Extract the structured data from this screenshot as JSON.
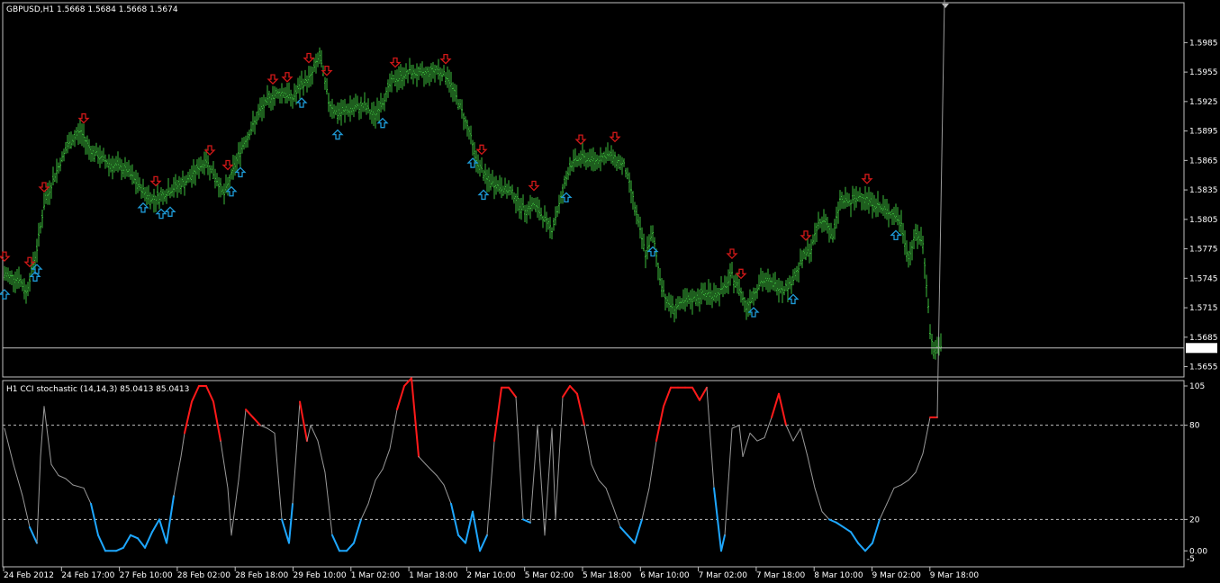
{
  "colors": {
    "background": "#000000",
    "frame": "#c0c0c0",
    "bar": "#3dbb3d",
    "buy_arrow": "#1e9ad6",
    "sell_arrow": "#d01818",
    "osc_line": "#9a9a9a",
    "osc_high": "#ff1a1a",
    "osc_low": "#1ea7ff",
    "price_tag_bg": "#ffffff",
    "price_tag_fg": "#000000"
  },
  "main_panel": {
    "title": "GBPUSD,H1  1.5668 1.5684 1.5668 1.5674",
    "price_ticks": [
      "1.5985",
      "1.5955",
      "1.5925",
      "1.5895",
      "1.5865",
      "1.5835",
      "1.5805",
      "1.5775",
      "1.5745",
      "1.5715",
      "1.5685",
      "1.5655"
    ],
    "current_price": "1.5674",
    "collapse_icon": "triangle-down-icon"
  },
  "sub_panel": {
    "title": "H1 CCI stochastic (14,14,3) 85.0413 85.0413",
    "level_ticks": [
      "105",
      "80",
      "20",
      "0.00"
    ],
    "second_bottom_tick": "-5"
  },
  "time_axis": [
    "24 Feb 2012",
    "24 Feb 17:00",
    "27 Feb 10:00",
    "28 Feb 02:00",
    "28 Feb 18:00",
    "29 Feb 10:00",
    "1 Mar 02:00",
    "1 Mar 18:00",
    "2 Mar 10:00",
    "5 Mar 02:00",
    "5 Mar 18:00",
    "6 Mar 10:00",
    "7 Mar 02:00",
    "7 Mar 18:00",
    "8 Mar 10:00",
    "9 Mar 02:00",
    "9 Mar 18:00"
  ],
  "chart_data": [
    {
      "type": "ohlc_bars",
      "symbol": "GBPUSD",
      "timeframe": "H1",
      "ylim": [
        1.565,
        1.6
      ],
      "close_path": [
        [
          0,
          1.5748
        ],
        [
          8,
          1.5745
        ],
        [
          12,
          1.573
        ],
        [
          18,
          1.5775
        ],
        [
          22,
          1.582
        ],
        [
          28,
          1.585
        ],
        [
          35,
          1.588
        ],
        [
          42,
          1.5895
        ],
        [
          48,
          1.5875
        ],
        [
          58,
          1.5862
        ],
        [
          68,
          1.5855
        ],
        [
          75,
          1.5838
        ],
        [
          82,
          1.5825
        ],
        [
          88,
          1.583
        ],
        [
          95,
          1.5838
        ],
        [
          102,
          1.5845
        ],
        [
          108,
          1.5858
        ],
        [
          112,
          1.5865
        ],
        [
          118,
          1.5845
        ],
        [
          122,
          1.583
        ],
        [
          126,
          1.585
        ],
        [
          132,
          1.588
        ],
        [
          138,
          1.59
        ],
        [
          142,
          1.5915
        ],
        [
          148,
          1.593
        ],
        [
          155,
          1.5935
        ],
        [
          160,
          1.5928
        ],
        [
          165,
          1.5942
        ],
        [
          170,
          1.595
        ],
        [
          175,
          1.5972
        ],
        [
          180,
          1.5925
        ],
        [
          185,
          1.5912
        ],
        [
          192,
          1.5918
        ],
        [
          200,
          1.592
        ],
        [
          205,
          1.591
        ],
        [
          210,
          1.5925
        ],
        [
          215,
          1.5945
        ],
        [
          220,
          1.595
        ],
        [
          225,
          1.5955
        ],
        [
          232,
          1.5952
        ],
        [
          240,
          1.5958
        ],
        [
          246,
          1.595
        ],
        [
          252,
          1.5925
        ],
        [
          258,
          1.5895
        ],
        [
          262,
          1.5865
        ],
        [
          268,
          1.5845
        ],
        [
          275,
          1.5838
        ],
        [
          282,
          1.5832
        ],
        [
          288,
          1.5815
        ],
        [
          294,
          1.582
        ],
        [
          300,
          1.5805
        ],
        [
          304,
          1.5795
        ],
        [
          308,
          1.582
        ],
        [
          314,
          1.586
        ],
        [
          320,
          1.5868
        ],
        [
          328,
          1.5865
        ],
        [
          334,
          1.587
        ],
        [
          338,
          1.5868
        ],
        [
          344,
          1.586
        ],
        [
          348,
          1.5835
        ],
        [
          352,
          1.58
        ],
        [
          356,
          1.577
        ],
        [
          360,
          1.579
        ],
        [
          364,
          1.5745
        ],
        [
          368,
          1.572
        ],
        [
          372,
          1.5715
        ],
        [
          378,
          1.572
        ],
        [
          384,
          1.5725
        ],
        [
          390,
          1.573
        ],
        [
          395,
          1.5728
        ],
        [
          400,
          1.5735
        ],
        [
          404,
          1.5748
        ],
        [
          408,
          1.5735
        ],
        [
          412,
          1.5715
        ],
        [
          416,
          1.573
        ],
        [
          420,
          1.5742
        ],
        [
          426,
          1.574
        ],
        [
          432,
          1.5735
        ],
        [
          436,
          1.5738
        ],
        [
          440,
          1.5752
        ],
        [
          444,
          1.5768
        ],
        [
          448,
          1.5775
        ],
        [
          452,
          1.58
        ],
        [
          456,
          1.5805
        ],
        [
          460,
          1.5785
        ],
        [
          464,
          1.5825
        ],
        [
          470,
          1.5822
        ],
        [
          476,
          1.583
        ],
        [
          482,
          1.5822
        ],
        [
          488,
          1.5815
        ],
        [
          494,
          1.581
        ],
        [
          498,
          1.58
        ],
        [
          502,
          1.5765
        ],
        [
          506,
          1.579
        ],
        [
          510,
          1.578
        ],
        [
          512,
          1.574
        ],
        [
          514,
          1.569
        ],
        [
          516,
          1.567
        ],
        [
          520,
          1.5675
        ]
      ],
      "current_price": 1.5674,
      "sell_arrows_at": [
        0,
        14,
        22,
        44,
        84,
        114,
        124,
        149,
        157,
        169,
        179,
        217,
        245,
        265,
        294,
        320,
        339,
        404,
        409,
        445,
        479
      ],
      "buy_arrows_at": [
        0,
        17,
        18,
        77,
        87,
        92,
        126,
        131,
        165,
        185,
        210,
        260,
        266,
        312,
        360,
        416,
        438,
        495
      ]
    },
    {
      "type": "line",
      "name": "H1 CCI stochastic (14,14,3)",
      "ylim": [
        -5,
        105
      ],
      "levels": [
        80,
        20
      ],
      "upper_colored_above": 80,
      "lower_colored_below": 20,
      "x": [
        0,
        5,
        10,
        14,
        18,
        20,
        22,
        26,
        30,
        34,
        38,
        44,
        48,
        52,
        56,
        62,
        66,
        70,
        74,
        78,
        82,
        86,
        90,
        94,
        98,
        100,
        104,
        108,
        112,
        116,
        120,
        124,
        126,
        130,
        134,
        138,
        142,
        146,
        150,
        154,
        158,
        160,
        164,
        168,
        170,
        174,
        178,
        182,
        186,
        190,
        194,
        198,
        202,
        206,
        210,
        214,
        218,
        222,
        226,
        230,
        234,
        240,
        244,
        248,
        252,
        256,
        260,
        264,
        268,
        272,
        276,
        280,
        284,
        288,
        292,
        296,
        300,
        304,
        306,
        310,
        314,
        318,
        322,
        326,
        330,
        334,
        338,
        342,
        346,
        350,
        354,
        358,
        362,
        366,
        370,
        374,
        378,
        382,
        386,
        390,
        394,
        398,
        400,
        404,
        408,
        410,
        414,
        418,
        422,
        426,
        430,
        434,
        438,
        442,
        446,
        450,
        454,
        458,
        462,
        466,
        470,
        474,
        478,
        482,
        486,
        490,
        494,
        498,
        502,
        506,
        510,
        514,
        518,
        522
      ],
      "values": [
        78,
        55,
        35,
        15,
        5,
        60,
        92,
        55,
        48,
        46,
        42,
        40,
        30,
        10,
        0,
        0,
        2,
        10,
        8,
        2,
        12,
        20,
        5,
        35,
        60,
        75,
        95,
        105,
        105,
        95,
        70,
        40,
        10,
        45,
        90,
        85,
        80,
        78,
        75,
        20,
        5,
        30,
        95,
        70,
        80,
        70,
        50,
        10,
        0,
        0,
        5,
        20,
        30,
        45,
        52,
        65,
        90,
        105,
        110,
        60,
        55,
        48,
        42,
        30,
        10,
        5,
        25,
        0,
        10,
        70,
        104,
        104,
        98,
        20,
        18,
        80,
        10,
        78,
        20,
        98,
        105,
        100,
        80,
        55,
        45,
        40,
        28,
        15,
        10,
        5,
        20,
        40,
        70,
        92,
        104,
        104,
        104,
        104,
        96,
        104,
        40,
        0,
        10,
        78,
        80,
        60,
        75,
        70,
        72,
        85,
        100,
        80,
        70,
        78,
        60,
        40,
        25,
        20,
        18,
        15,
        12,
        5,
        0,
        5,
        20,
        30,
        40,
        42,
        45,
        50,
        62,
        85,
        85
      ]
    }
  ]
}
